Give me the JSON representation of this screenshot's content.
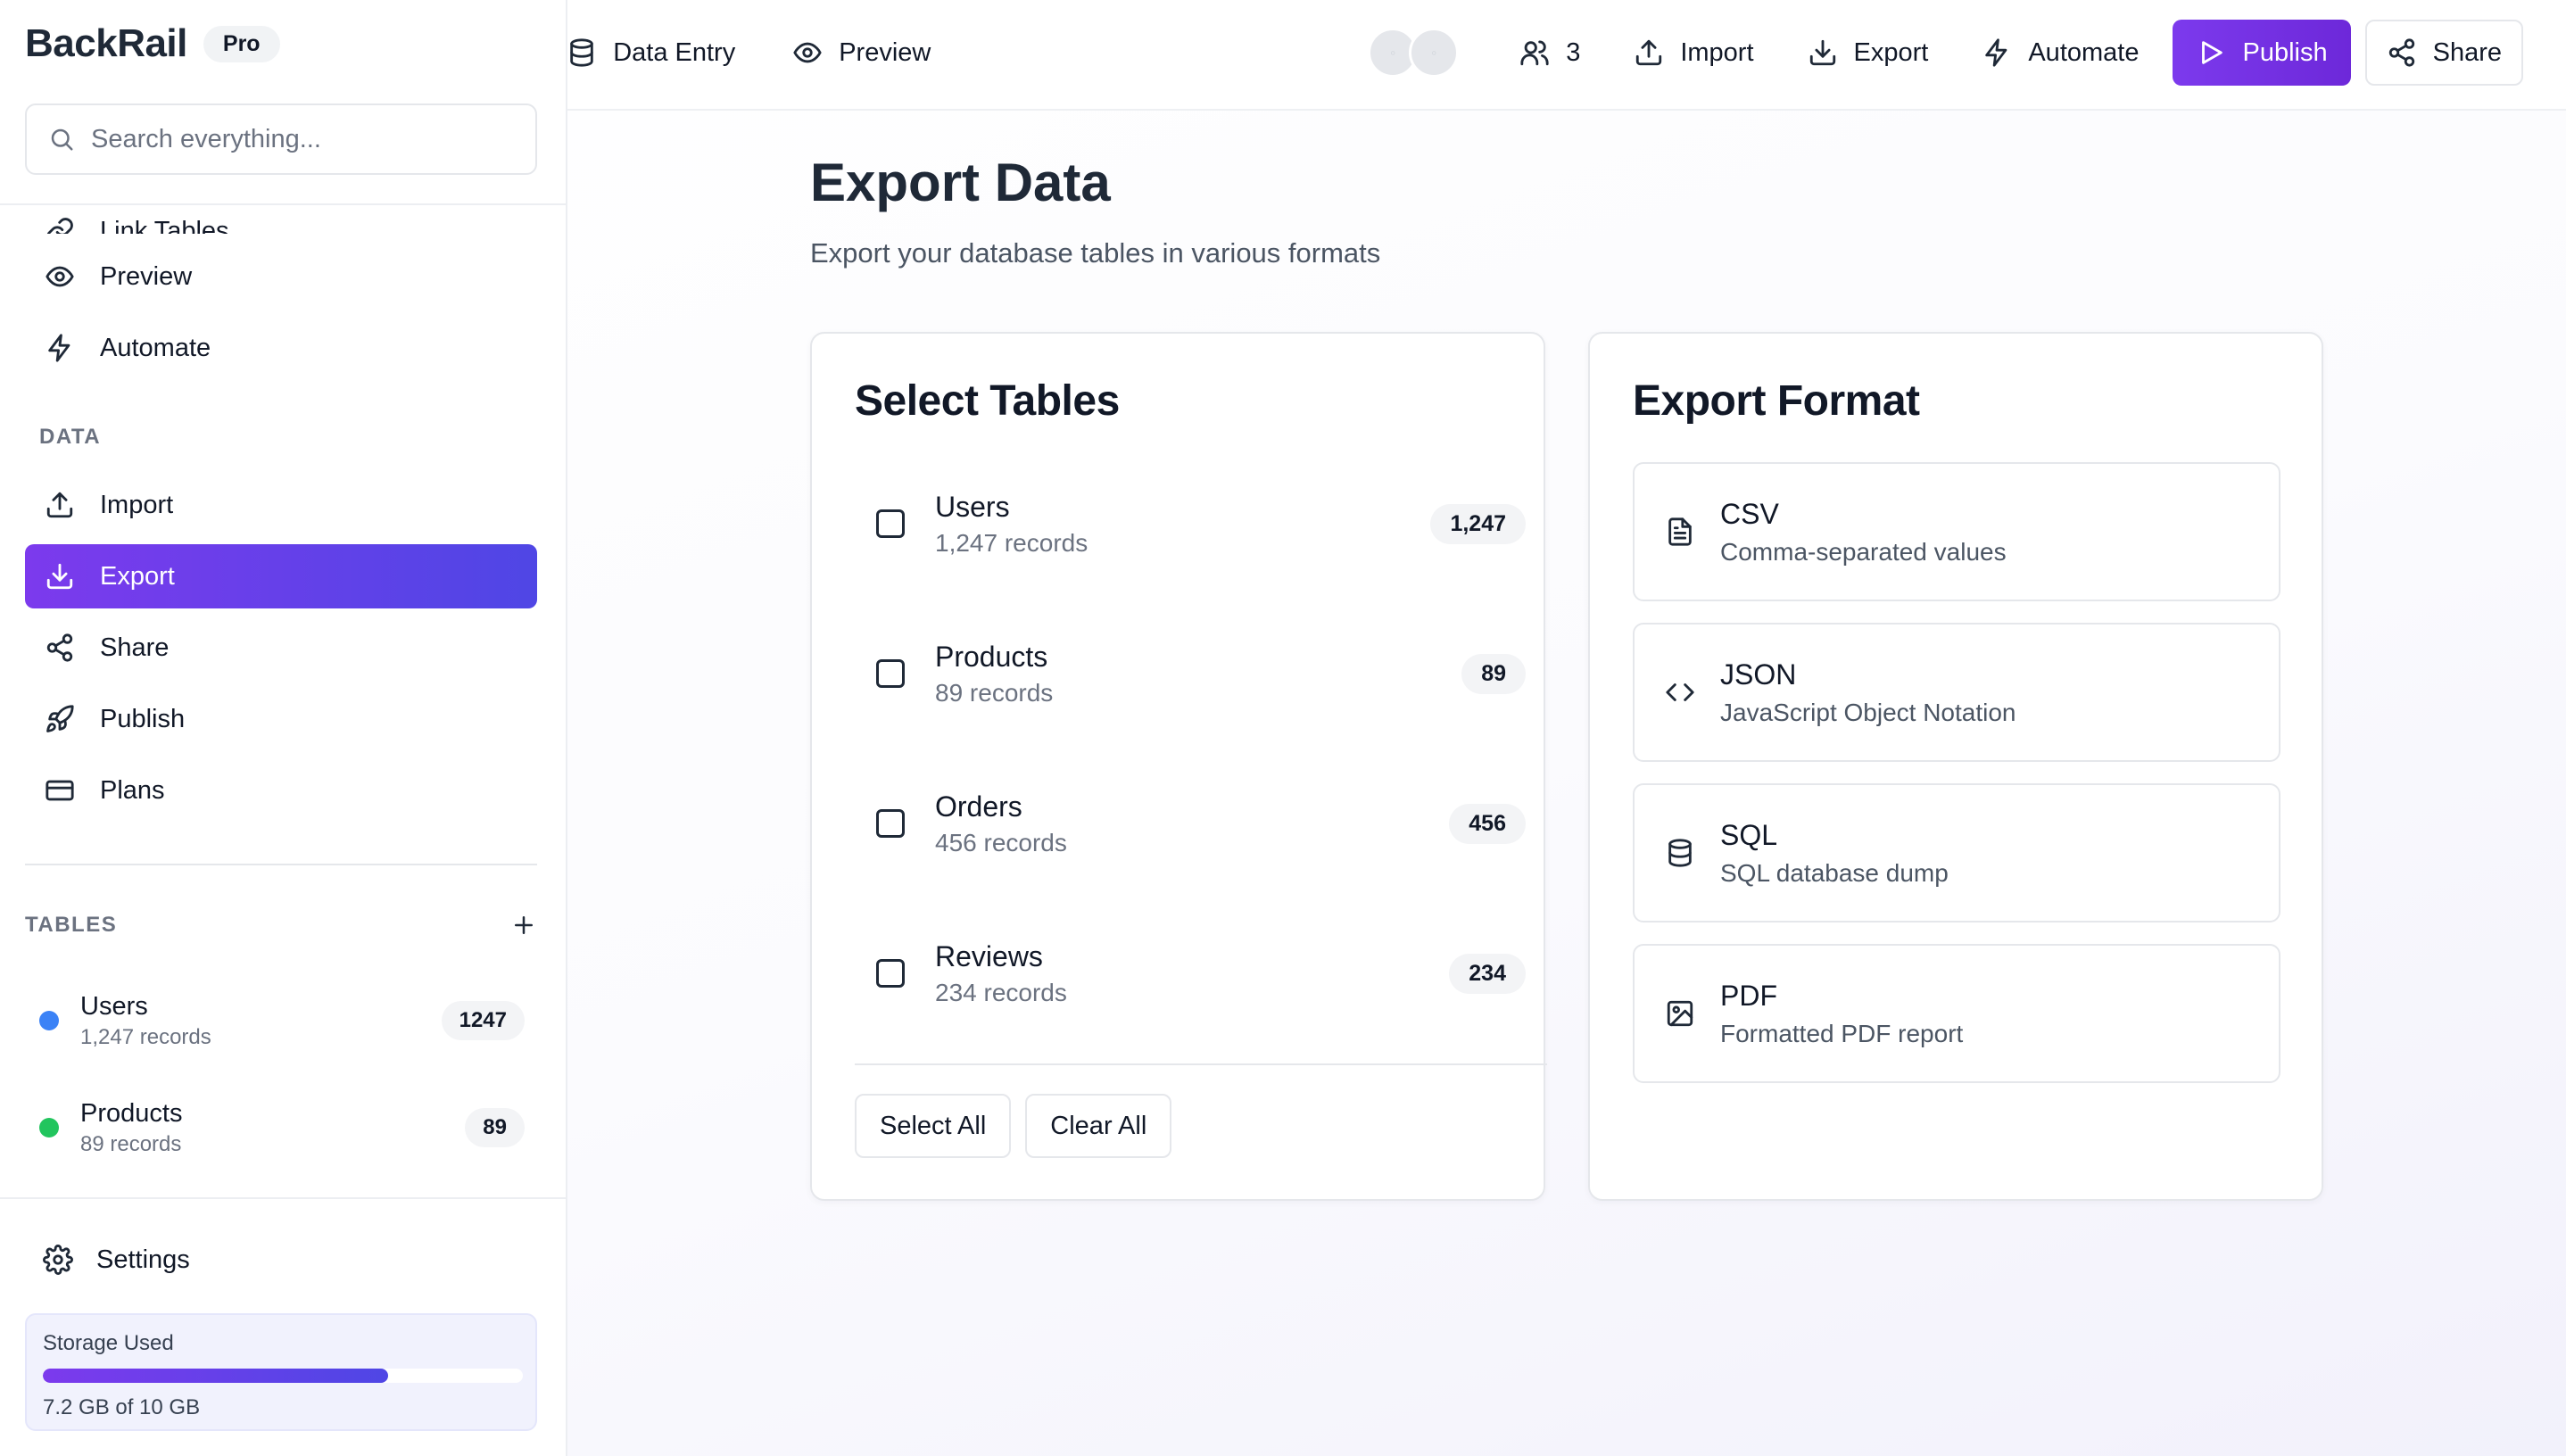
{
  "app": {
    "name": "BackRail",
    "badge": "Pro"
  },
  "search": {
    "placeholder": "Search everything..."
  },
  "topnav": {
    "left": [
      {
        "label": "Data Entry",
        "icon": "database-icon"
      },
      {
        "label": "Preview",
        "icon": "eye-icon"
      }
    ],
    "collaborators_count": "3",
    "import_label": "Import",
    "export_label": "Export",
    "automate_label": "Automate",
    "publish_label": "Publish",
    "share_label": "Share"
  },
  "sidebar": {
    "clipped_item": "Link Tables",
    "nav": [
      {
        "label": "Preview",
        "icon": "eye-icon"
      },
      {
        "label": "Automate",
        "icon": "bolt-icon"
      }
    ],
    "data_section_label": "DATA",
    "data_items": [
      {
        "label": "Import",
        "icon": "upload-icon"
      },
      {
        "label": "Export",
        "icon": "download-icon",
        "active": true
      },
      {
        "label": "Share",
        "icon": "share-icon"
      },
      {
        "label": "Publish",
        "icon": "rocket-icon"
      },
      {
        "label": "Plans",
        "icon": "card-icon"
      }
    ],
    "tables_section_label": "TABLES",
    "tables": [
      {
        "name": "Users",
        "records": "1,247 records",
        "count": "1247",
        "color": "#3b82f6"
      },
      {
        "name": "Products",
        "records": "89 records",
        "count": "89",
        "color": "#22c55e"
      }
    ],
    "settings_label": "Settings",
    "storage": {
      "title": "Storage Used",
      "used_fraction": 0.72,
      "text": "7.2 GB of 10 GB"
    }
  },
  "main": {
    "title": "Export Data",
    "subtitle": "Export your database tables in various formats",
    "select_tables": {
      "title": "Select Tables",
      "rows": [
        {
          "name": "Users",
          "records": "1,247 records",
          "count": "1,247"
        },
        {
          "name": "Products",
          "records": "89 records",
          "count": "89"
        },
        {
          "name": "Orders",
          "records": "456 records",
          "count": "456"
        },
        {
          "name": "Reviews",
          "records": "234 records",
          "count": "234"
        }
      ],
      "select_all_label": "Select All",
      "clear_all_label": "Clear All"
    },
    "export_format": {
      "title": "Export Format",
      "formats": [
        {
          "name": "CSV",
          "description": "Comma-separated values",
          "icon": "file-text-icon"
        },
        {
          "name": "JSON",
          "description": "JavaScript Object Notation",
          "icon": "code-icon"
        },
        {
          "name": "SQL",
          "description": "SQL database dump",
          "icon": "database-icon"
        },
        {
          "name": "PDF",
          "description": "Formatted PDF report",
          "icon": "image-icon"
        }
      ]
    }
  },
  "colors": {
    "accent": "#7c3aed",
    "accent_end": "#4f46e5"
  }
}
